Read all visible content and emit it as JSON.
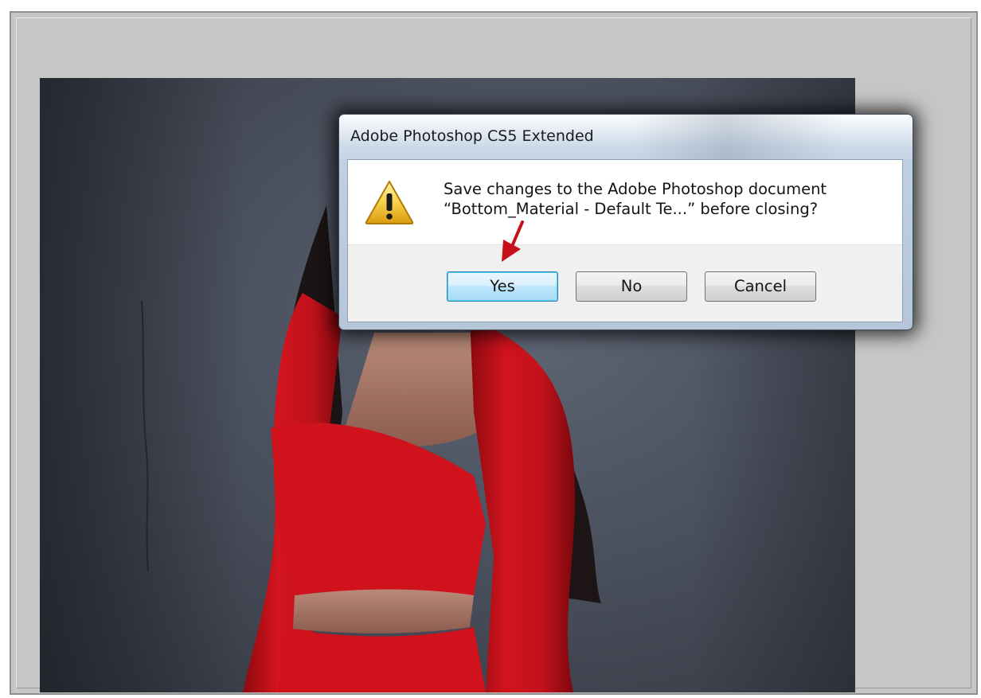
{
  "dialog": {
    "title": "Adobe Photoshop CS5 Extended",
    "message_line1": "Save changes to the Adobe Photoshop document",
    "message_line2": "“Bottom_Material - Default Te...” before closing?",
    "icon": "warning-icon",
    "buttons": {
      "yes": "Yes",
      "no": "No",
      "cancel": "Cancel"
    },
    "default_button": "yes"
  },
  "annotation": {
    "icon": "red-arrow-pointer",
    "color": "#c8101a"
  },
  "colors": {
    "workspace_gray": "#c6c6c6",
    "canvas_backdrop": "#4a505d",
    "garment_red": "#d4141e",
    "default_button_blue": "#bee6fd"
  }
}
